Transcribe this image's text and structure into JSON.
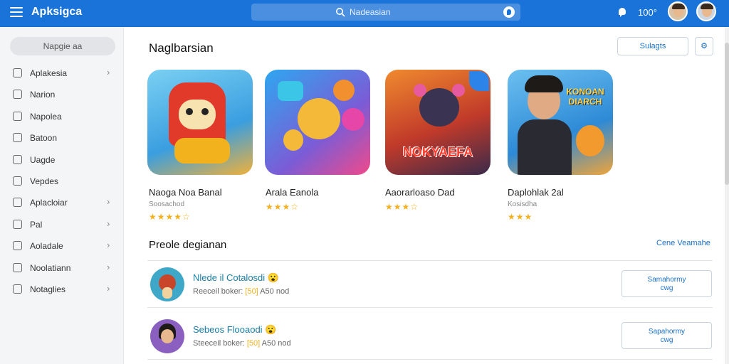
{
  "app": {
    "title": "Apksigca"
  },
  "search": {
    "placeholder": "Nadeasian"
  },
  "header": {
    "count": "100°"
  },
  "sidebar": {
    "button": "Napgie aa",
    "items": [
      {
        "label": "Aplakesia",
        "icon": "apps-icon",
        "chevron": true
      },
      {
        "label": "Narion",
        "icon": "chat-icon",
        "chevron": false
      },
      {
        "label": "Napolea",
        "icon": "smiley-icon",
        "chevron": false
      },
      {
        "label": "Batoon",
        "icon": "book-icon",
        "chevron": false
      },
      {
        "label": "Uagde",
        "icon": "clipboard-icon",
        "chevron": false
      },
      {
        "label": "Vepdes",
        "icon": "drop-icon",
        "chevron": false
      },
      {
        "label": "Aplacloiar",
        "icon": "puzzle-icon",
        "chevron": true
      },
      {
        "label": "Pal",
        "icon": "chart-icon",
        "chevron": true
      },
      {
        "label": "Aoladale",
        "icon": "pin-icon",
        "chevron": true
      },
      {
        "label": "Noolatiann",
        "icon": "card-icon",
        "chevron": true
      },
      {
        "label": "Notaglies",
        "icon": "user-icon",
        "chevron": true
      }
    ]
  },
  "featured": {
    "title": "Naglbarsian",
    "button": "Sulagts",
    "apps": [
      {
        "name": "Naoga Noa Banal",
        "sub": "Soosachod",
        "rating": 4
      },
      {
        "name": "Arala Eanola",
        "sub": "",
        "rating": 3.5
      },
      {
        "name": "Aaorarloaso Dad",
        "sub": "",
        "rating": 3.5
      },
      {
        "name": "Daplohlak 2al",
        "sub": "Kosisdha",
        "rating": 3
      }
    ],
    "tile_texts": [
      "NOKYAEFA",
      "KONOAN DIARCH"
    ]
  },
  "popular": {
    "title": "Preole degianan",
    "see_all": "Cene Veamahe",
    "rows": [
      {
        "title": "Nlede il Cotalosdi 😮",
        "meta_a": "Reeceil boker:",
        "meta_b": "[50]",
        "meta_c": "A50 nod",
        "button_a": "Samahormy",
        "button_b": "cwg"
      },
      {
        "title": "Sebeos Flooaodi 😮",
        "meta_a": "Steeceil boker:",
        "meta_b": "[50]",
        "meta_c": "A50 nod",
        "button_a": "Sapahormy",
        "button_b": "cwg"
      }
    ]
  },
  "colors": {
    "primary": "#1a73d9",
    "link": "#1a6fc7",
    "star": "#f2b01e"
  }
}
